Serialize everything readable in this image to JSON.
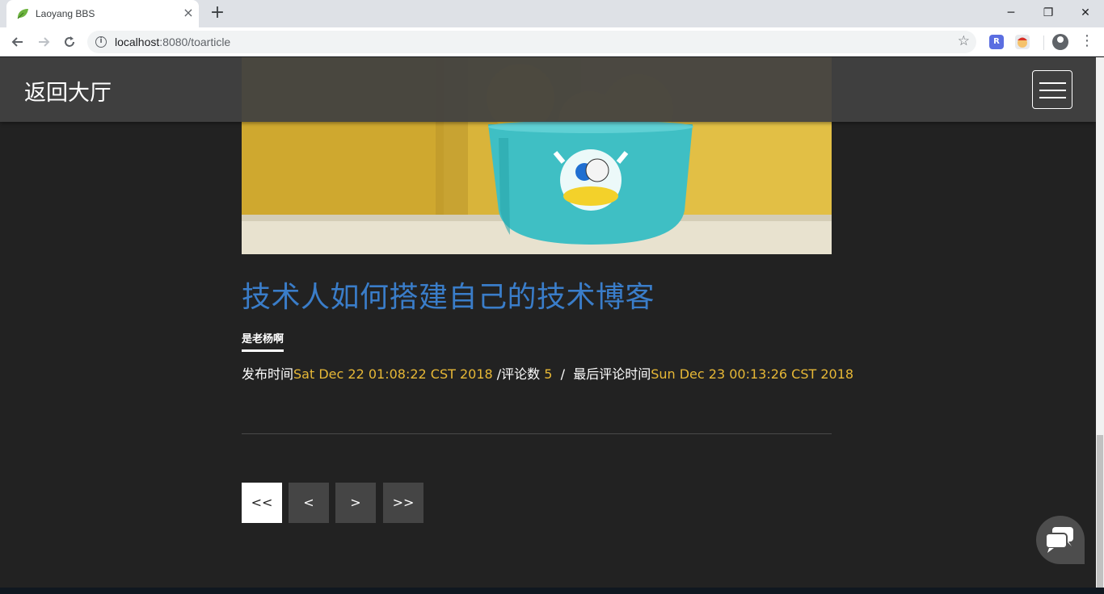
{
  "browser": {
    "tab_title": "Laoyang BBS",
    "tab_close": "×",
    "new_tab": "+",
    "url_host": "localhost",
    "url_rest": ":8080/toarticle",
    "ext_r": "R",
    "window_min": "─",
    "window_restore": "❐",
    "window_close": "✕"
  },
  "nav": {
    "back_label": "返回大厅"
  },
  "article": {
    "title": "技术人如何搭建自己的技术博客",
    "author": "是老杨啊",
    "published_label": "发布时间",
    "published_at": "Sat Dec 22 01:08:22 CST 2018",
    "comments_label": " /评论数 ",
    "comments_count": "5",
    "last_comment_label": "  /  最后评论时间",
    "last_comment_at": "Sun Dec 23 00:13:26 CST 2018"
  },
  "pagination": {
    "first": "<<",
    "prev": "<",
    "next": ">",
    "last": ">>"
  },
  "colors": {
    "accent_title": "#3a7dc9",
    "highlight": "#e7b836",
    "background": "#222222"
  }
}
